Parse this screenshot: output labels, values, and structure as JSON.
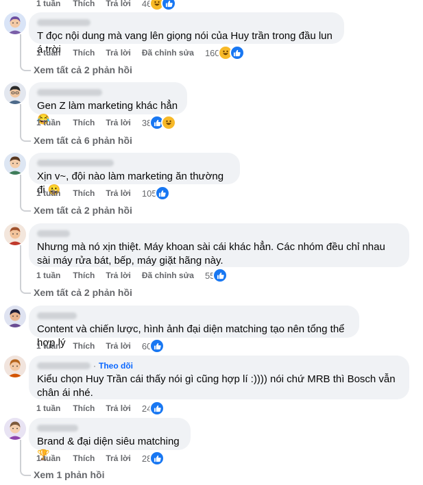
{
  "labels": {
    "like": "Thích",
    "reply": "Trả lời",
    "edited": "Đã chỉnh sửa",
    "follow": "Theo dõi"
  },
  "top_partial": {
    "age": "1 tuần",
    "count": "46"
  },
  "comments": [
    {
      "age": "1 tuần",
      "text": "T đọc nội dung mà vang lên giọng nói của Huy trần trong đầu lun á trời",
      "count": "160",
      "edited": true,
      "reactions": [
        "haha-icon",
        "like-icon"
      ],
      "replies": "Xem tất cả 2 phản hồi"
    },
    {
      "age": "1 tuần",
      "text": "Gen Z làm marketing khác hẳn 😂",
      "count": "38",
      "edited": false,
      "reactions": [
        "like-icon",
        "haha-icon"
      ],
      "replies": "Xem tất cả 6 phản hồi"
    },
    {
      "age": "1 tuần",
      "text": "Xịn v~, đội nào làm marketing ăn thường đi 😀",
      "count": "105",
      "edited": false,
      "reactions": [
        "like-icon"
      ],
      "replies": "Xem tất cả 2 phản hồi"
    },
    {
      "age": "1 tuần",
      "text": "Nhưng mà nó xịn thiệt. Máy khoan sài cái khác hẳn. Các nhóm đều chỉ nhau sài máy rửa bát, bếp, máy giặt hãng này.",
      "count": "55",
      "edited": true,
      "reactions": [
        "like-icon"
      ],
      "replies": "Xem tất cả 2 phản hồi"
    },
    {
      "age": "1 tuần",
      "text": "Content và chiến lược, hình ảnh đại diện matching tạo nên tổng thể hợp lý",
      "count": "60",
      "edited": false,
      "reactions": [
        "like-icon"
      ],
      "replies": ""
    },
    {
      "age": "1 tuần",
      "text": "Kiểu chọn Huy Trần cái thấy nói gì cũng hợp lí :)))) nói chứ MRB thì Bosch vẫn chân ái nhé.",
      "count": "24",
      "edited": false,
      "reactions": [
        "like-icon"
      ],
      "replies": ""
    },
    {
      "age": "1 tuần",
      "text": "Brand & đại diện siêu matching 🏆",
      "count": "28",
      "edited": false,
      "reactions": [
        "like-icon"
      ],
      "replies": "Xem 1 phản hồi"
    }
  ],
  "colors": {
    "link": "#65676b",
    "bubble": "#f0f2f5",
    "like": "#1877f2",
    "haha": "#f7b928",
    "follow": "#0866ff"
  }
}
